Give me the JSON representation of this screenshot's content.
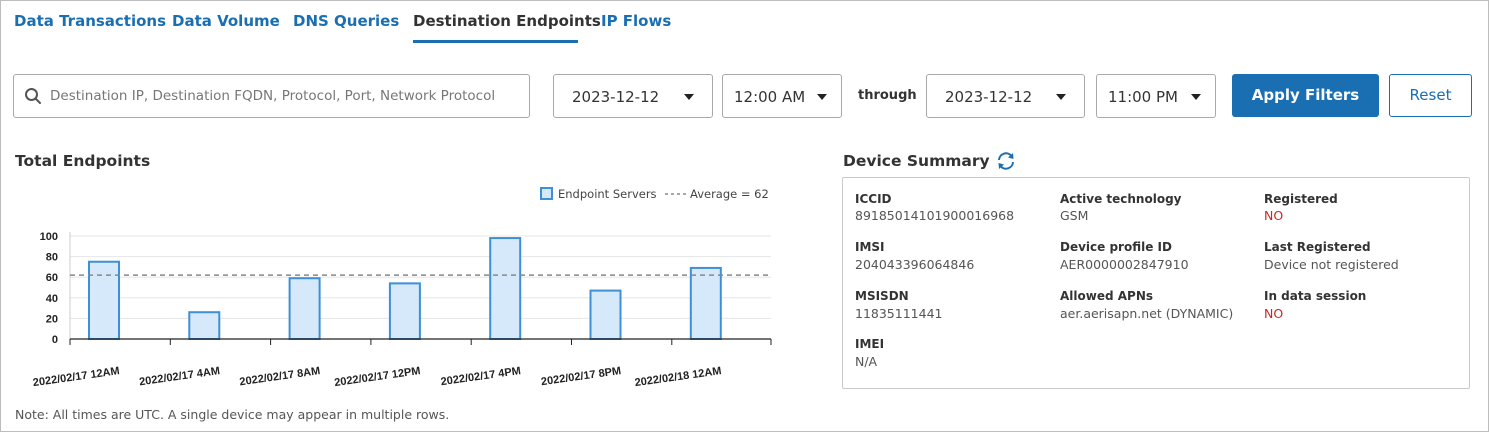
{
  "tabs": [
    {
      "label": "Data Transactions",
      "active": false
    },
    {
      "label": "Data Volume",
      "active": false
    },
    {
      "label": "DNS Queries",
      "active": false
    },
    {
      "label": "Destination Endpoints",
      "active": true
    },
    {
      "label": "IP Flows",
      "active": false
    }
  ],
  "filters": {
    "search_placeholder": "Destination IP, Destination FQDN, Protocol, Port, Network Protocol",
    "start_date": "2023-12-12",
    "start_time": "12:00 AM",
    "through_label": "through",
    "end_date": "2023-12-12",
    "end_time": "11:00 PM",
    "apply_label": "Apply Filters",
    "reset_label": "Reset"
  },
  "chart_section": {
    "title": "Total Endpoints"
  },
  "chart_data": {
    "type": "bar",
    "categories": [
      "2022/02/17 12AM",
      "2022/02/17 4AM",
      "2022/02/17 8AM",
      "2022/02/17 12PM",
      "2022/02/17 4PM",
      "2022/02/17 8PM",
      "2022/02/18 12AM"
    ],
    "series": [
      {
        "name": "Endpoint Servers",
        "values": [
          75,
          26,
          59,
          54,
          98,
          47,
          69
        ]
      }
    ],
    "average": {
      "label": "Average = 62",
      "value": 62
    },
    "yticks": [
      0,
      20,
      40,
      60,
      80,
      100
    ],
    "ylim": [
      0,
      100
    ],
    "legend_position": "top-right",
    "grid": true,
    "colors": {
      "bar_fill": "#d6e9fb",
      "bar_stroke": "#3d8fd6",
      "average_line": "#888888",
      "grid": "#e6e6e6"
    }
  },
  "device_summary": {
    "title": "Device Summary",
    "refresh_icon": "refresh-icon",
    "fields": [
      {
        "label": "ICCID",
        "value": "89185014101900016968",
        "status": false
      },
      {
        "label": "Active technology",
        "value": "GSM",
        "status": false
      },
      {
        "label": "Registered",
        "value": "NO",
        "status": true
      },
      {
        "label": "IMSI",
        "value": "204043396064846",
        "status": false
      },
      {
        "label": "Device profile ID",
        "value": "AER0000002847910",
        "status": false
      },
      {
        "label": "Last Registered",
        "value": "Device not registered",
        "status": false
      },
      {
        "label": "MSISDN",
        "value": "11835111441",
        "status": false
      },
      {
        "label": "Allowed APNs",
        "value": "aer.aerisapn.net (DYNAMIC)",
        "status": false
      },
      {
        "label": "In data session",
        "value": "NO",
        "status": true
      },
      {
        "label": "IMEI",
        "value": "N/A",
        "status": false
      }
    ]
  },
  "note": "Note: All times are UTC. A single device may appear in multiple rows.",
  "colors": {
    "accent": "#1a6fb3",
    "status_negative": "#c62828"
  }
}
